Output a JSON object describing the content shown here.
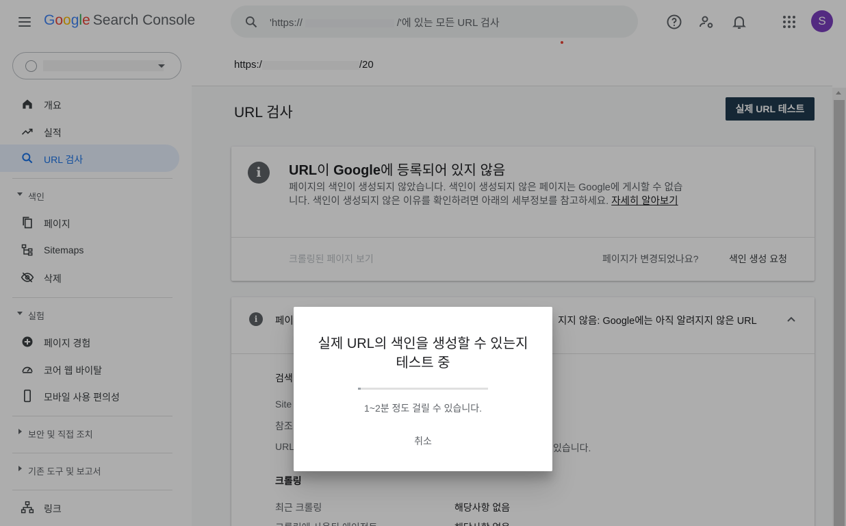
{
  "header": {
    "logo_google": "Google",
    "logo_product": "Search Console",
    "search_prefix": "'https://",
    "search_suffix": "/'에 있는 모든 URL 검사",
    "avatar_initial": "S",
    "icons": [
      "help-icon",
      "manage-users-icon",
      "notifications-icon",
      "apps-grid-icon"
    ]
  },
  "sidebar": {
    "items_top": [
      {
        "label": "개요",
        "icon": "home-icon"
      },
      {
        "label": "실적",
        "icon": "trending-up-icon"
      },
      {
        "label": "URL 검사",
        "icon": "search-icon",
        "active": true
      }
    ],
    "section_index": "색인",
    "items_index": [
      {
        "label": "페이지",
        "icon": "pages-icon"
      },
      {
        "label": "Sitemaps",
        "icon": "sitemap-icon"
      },
      {
        "label": "삭제",
        "icon": "removal-icon"
      }
    ],
    "section_experience": "실험",
    "items_experience": [
      {
        "label": "페이지 경험",
        "icon": "plus-circle-icon"
      },
      {
        "label": "코어 웹 바이탈",
        "icon": "speed-icon"
      },
      {
        "label": "모바일 사용 편의성",
        "icon": "phone-icon"
      }
    ],
    "section_security": "보안 및 직접 조치",
    "section_legacy": "기존 도구 및 보고서",
    "item_links": {
      "label": "링크",
      "icon": "links-icon"
    }
  },
  "main": {
    "url_prefix": "https:/",
    "url_suffix": "/20",
    "page_title": "URL 검사",
    "live_test_button": "실제 URL 테스트",
    "status_card": {
      "title_pre": "URL",
      "title_mid": "이 ",
      "title_google": "Google",
      "title_post": "에 등록되어 있지 않음",
      "description": "페이지의 색인이 생성되지 않았습니다. 색인이 생성되지 않은 페이지는 Google에 게시할 수 없습니다. 색인이 생성되지 않은 이유를 확인하려면 아래의 세부정보를 참고하세요. ",
      "learn_more": "자세히 알아보기",
      "crawled_page": "크롤링된 페이지 보기",
      "page_changed": "페이지가 변경되었나요?",
      "request_indexing": "색인 생성 요청"
    },
    "detail_card": {
      "header_left": "페이",
      "header_right": "지지 않음: Google에는 아직 알려지지 않은 URL",
      "row_labels": [
        "검색",
        "Site",
        "참조",
        "URL"
      ],
      "url_row_tail": "있습니다.",
      "crawl_heading": "크롤링",
      "last_crawl_label": "최근 크롤링",
      "last_crawl_value": "해당사항 없음",
      "agent_label": "크롤링에 사용된 에이전트",
      "agent_value": "해당사항 없음"
    }
  },
  "dialog": {
    "title": "실제 URL의 색인을 생성할 수 있는지 테스트 중",
    "progress_fraction": 0.02,
    "subtitle": "1~2분 정도 걸릴 수 있습니다.",
    "cancel": "취소"
  }
}
